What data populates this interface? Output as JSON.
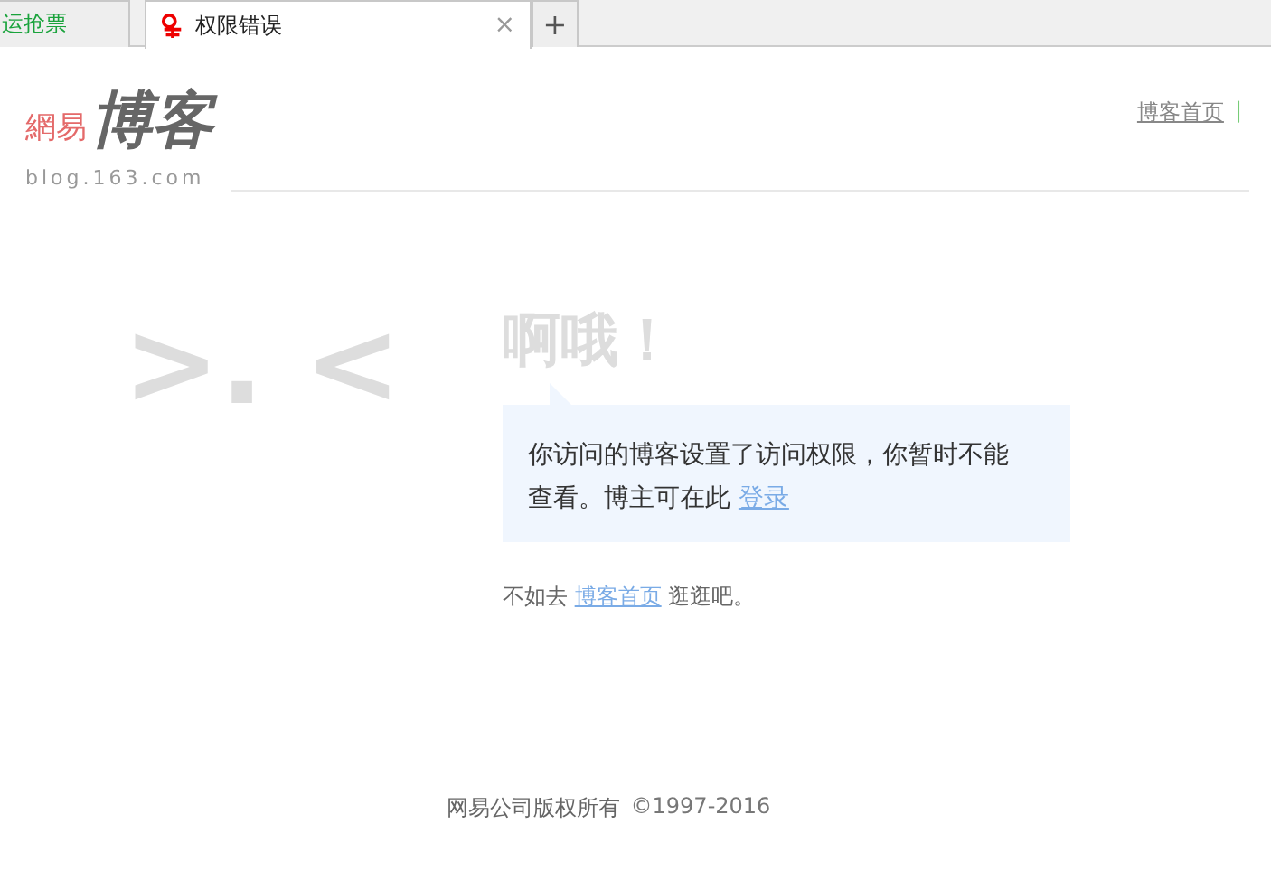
{
  "tabs": [
    {
      "label": "运抢票",
      "selected": false,
      "kind": "text"
    },
    {
      "label": "权限错误",
      "selected": true,
      "kind": "favicon",
      "close": "×"
    }
  ],
  "new_tab": "+",
  "logo": {
    "brand": "網易",
    "name": "博客",
    "url": "blog.163.com"
  },
  "nav": {
    "link": "博客首页",
    "separator": "|"
  },
  "emoticon": ">. <",
  "title": "啊哦！",
  "message": {
    "text": "你访问的博客设置了访问权限，你暂时不能查看。博主可在此",
    "link": "登录"
  },
  "suggestion": {
    "before": "不如去",
    "link": "博客首页",
    "after": "逛逛吧。"
  },
  "footer": {
    "text": "网易公司版权所有",
    "copyright": "©1997-2016"
  }
}
